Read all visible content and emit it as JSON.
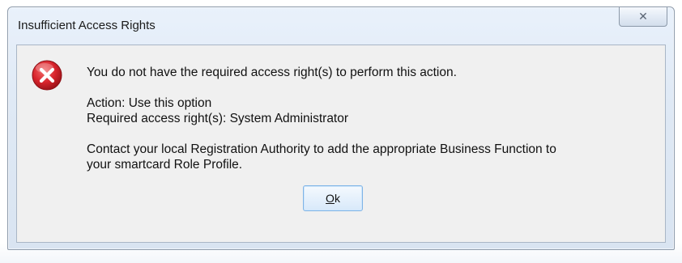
{
  "dialog": {
    "title": "Insufficient Access Rights",
    "close_icon": "close-icon",
    "error_icon": "error-icon",
    "message": {
      "line1": "You do not have the required access right(s) to perform this action.",
      "line2": "Action: Use this option",
      "line3": "Required access right(s): System Administrator",
      "line4": "Contact your local Registration Authority to add the appropriate Business Function to",
      "line5": "your smartcard Role Profile."
    },
    "ok_button": {
      "mnemonic": "O",
      "rest": "k"
    },
    "colors": {
      "error_red": "#d8242c",
      "button_border": "#7fb4e6",
      "frame_border": "#8e9bab"
    }
  }
}
